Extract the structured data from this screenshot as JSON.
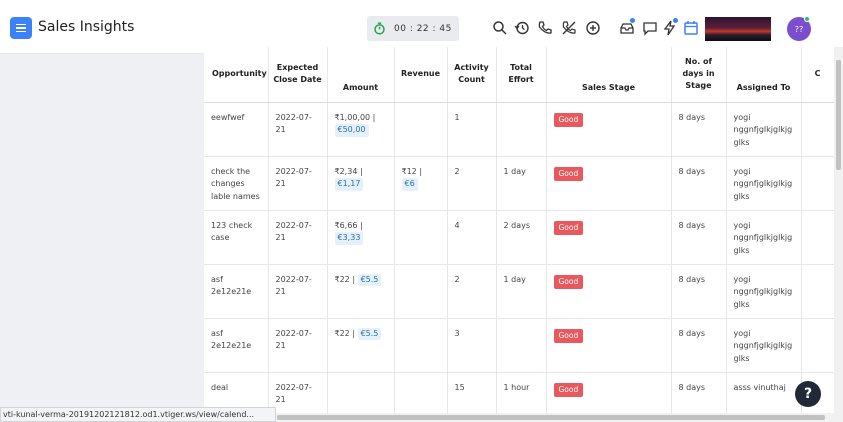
{
  "app": {
    "title": "Sales Insights"
  },
  "timer": {
    "value": "00 : 22 : 45"
  },
  "avatar": {
    "initials": "??"
  },
  "help": {
    "label": "?"
  },
  "status_bar": {
    "url": "vti-kunal-verma-20191202121812.od1.vtiger.ws/view/calend..."
  },
  "colors": {
    "accent": "#3b82f6",
    "badge": "#e8585c",
    "pill_bg": "#e4f1fb"
  },
  "icons": [
    "menu-icon",
    "stopwatch-icon",
    "search-icon",
    "history-icon",
    "phone-icon",
    "mute-icon",
    "plus-icon",
    "inbox-icon",
    "chat-icon",
    "lightning-icon",
    "calendar-icon"
  ],
  "table": {
    "headers": [
      "Opportunity",
      "Expected Close Date",
      "Amount",
      "Revenue",
      "Activity Count",
      "Total Effort",
      "Sales Stage",
      "No. of days in Stage",
      "Assigned To",
      "C"
    ],
    "rows": [
      {
        "opportunity": "eewfwef",
        "close_date": "2022-07-21",
        "amount_inr": "₹1,00,00 |",
        "amount_eur": "€50,00",
        "revenue_inr": "",
        "revenue_eur": "",
        "activity": "1",
        "effort": "",
        "stage": "Good",
        "days": "8 days",
        "assigned": "yogi nggnfjglkjglkjg glks"
      },
      {
        "opportunity": "check the changes lable names",
        "close_date": "2022-07-21",
        "amount_inr": "₹2,34 |",
        "amount_eur": "€1,17",
        "revenue_inr": "₹12 |",
        "revenue_eur": "€6",
        "activity": "2",
        "effort": "1 day",
        "stage": "Good",
        "days": "8 days",
        "assigned": "yogi nggnfjglkjglkjg glks"
      },
      {
        "opportunity": "123 check case",
        "close_date": "2022-07-21",
        "amount_inr": "₹6,66 |",
        "amount_eur": "€3,33",
        "revenue_inr": "",
        "revenue_eur": "",
        "activity": "4",
        "effort": "2 days",
        "stage": "Good",
        "days": "8 days",
        "assigned": "yogi nggnfjglkjglkjg glks"
      },
      {
        "opportunity": "asf 2e12e21e",
        "close_date": "2022-07-21",
        "amount_inr": "₹22 |",
        "amount_eur": "€5.5",
        "revenue_inr": "",
        "revenue_eur": "",
        "activity": "2",
        "effort": "1 day",
        "stage": "Good",
        "days": "8 days",
        "assigned": "yogi nggnfjglkjglkjg glks"
      },
      {
        "opportunity": "asf 2e12e21e",
        "close_date": "2022-07-21",
        "amount_inr": "₹22 |",
        "amount_eur": "€5.5",
        "revenue_inr": "",
        "revenue_eur": "",
        "activity": "3",
        "effort": "",
        "stage": "Good",
        "days": "8 days",
        "assigned": "yogi nggnfjglkjglkjg glks"
      },
      {
        "opportunity": "deal",
        "close_date": "2022-07-21",
        "amount_inr": "",
        "amount_eur": "",
        "revenue_inr": "",
        "revenue_eur": "",
        "activity": "15",
        "effort": "1 hour",
        "stage": "Good",
        "days": "8 days",
        "assigned": "asss vinuthaj"
      }
    ]
  }
}
